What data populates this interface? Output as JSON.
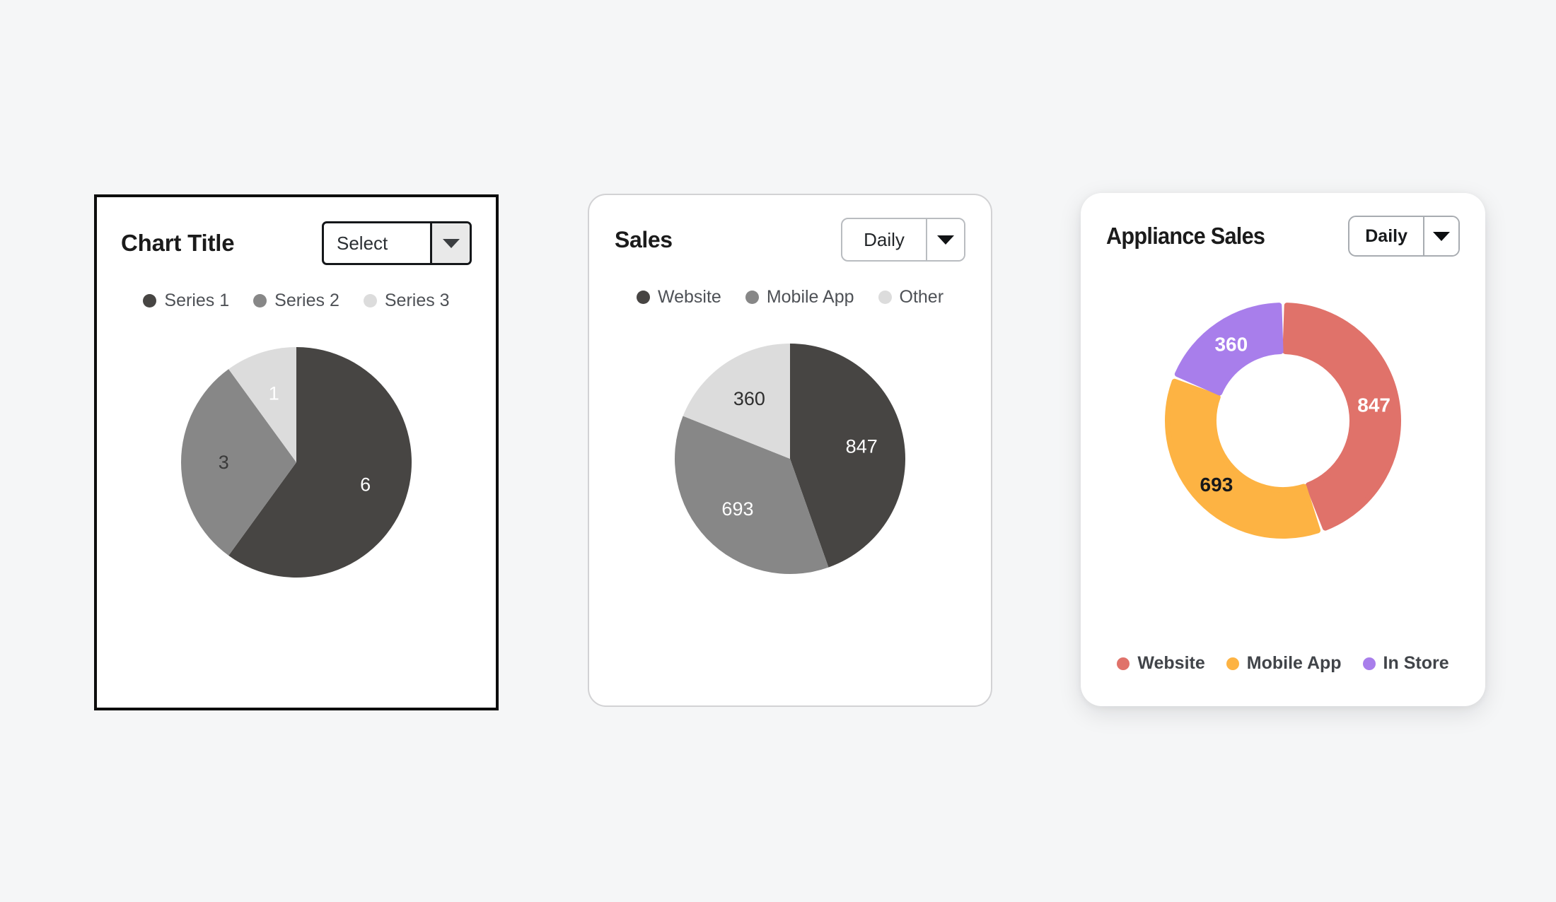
{
  "page": {
    "background_color": "#f5f6f7"
  },
  "cards": [
    {
      "id": "basic",
      "title": "Chart Title",
      "select": {
        "value": "Select",
        "arrow_icon": "chevron-down-icon"
      },
      "legend": [
        {
          "label": "Series 1",
          "color": "#474543"
        },
        {
          "label": "Series 2",
          "color": "#878787"
        },
        {
          "label": "Series 3",
          "color": "#dcdcdc"
        }
      ]
    },
    {
      "id": "sales",
      "title": "Sales",
      "select": {
        "value": "Daily",
        "arrow_icon": "chevron-down-icon"
      },
      "legend": [
        {
          "label": "Website",
          "color": "#474543"
        },
        {
          "label": "Mobile App",
          "color": "#878787"
        },
        {
          "label": "Other",
          "color": "#dcdcdc"
        }
      ]
    },
    {
      "id": "appliance",
      "title": "Appliance Sales",
      "select": {
        "value": "Daily",
        "arrow_icon": "chevron-down-icon"
      },
      "legend": [
        {
          "label": "Website",
          "color": "#e0726a"
        },
        {
          "label": "Mobile App",
          "color": "#fdb343"
        },
        {
          "label": "In Store",
          "color": "#a87eeb"
        }
      ]
    }
  ],
  "chart_data": [
    {
      "type": "pie",
      "title": "Chart Title",
      "categories": [
        "Series 1",
        "Series 2",
        "Series 3"
      ],
      "values": [
        6,
        3,
        1
      ],
      "colors": [
        "#474543",
        "#878787",
        "#dcdcdc"
      ],
      "labels": [
        "6",
        "3",
        "1"
      ],
      "label_colors": [
        "#ffffff",
        "#3a3a3a",
        "#ffffff"
      ],
      "legend_position": "top",
      "start_angle": 0,
      "direction": "clockwise",
      "total": 10,
      "radius": 163,
      "inner_radius": 0,
      "gap_degrees": 0
    },
    {
      "type": "pie",
      "title": "Sales",
      "categories": [
        "Website",
        "Mobile App",
        "Other"
      ],
      "values": [
        847,
        693,
        360
      ],
      "colors": [
        "#474543",
        "#878787",
        "#dcdcdc"
      ],
      "labels": [
        "847",
        "693",
        "360"
      ],
      "label_colors": [
        "#ffffff",
        "#ffffff",
        "#2e2e2e"
      ],
      "legend_position": "top",
      "start_angle": 0,
      "direction": "clockwise",
      "total": 1900,
      "radius": 163,
      "inner_radius": 0,
      "gap_degrees": 0
    },
    {
      "type": "pie",
      "title": "Appliance Sales",
      "categories": [
        "Website",
        "Mobile App",
        "In Store"
      ],
      "values": [
        847,
        693,
        360
      ],
      "colors": [
        "#e0726a",
        "#fdb343",
        "#a87eeb"
      ],
      "labels": [
        "847",
        "693",
        "360"
      ],
      "label_colors": [
        "#ffffff",
        "#17181a",
        "#ffffff"
      ],
      "legend_position": "bottom",
      "start_angle": 0,
      "direction": "clockwise",
      "total": 1900,
      "radius": 163,
      "inner_radius": 98,
      "gap_degrees": 4,
      "corner_rounding": 8
    }
  ]
}
